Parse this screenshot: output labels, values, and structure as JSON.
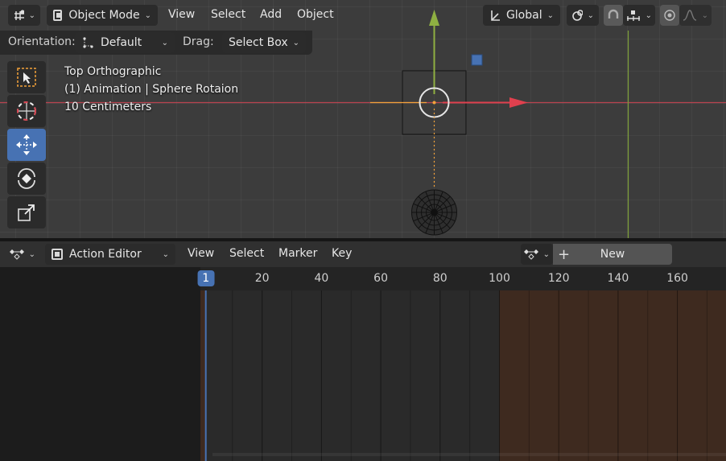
{
  "viewport_header": {
    "editor_type_icon": "grid-icon",
    "mode": "Object Mode",
    "menus": [
      "View",
      "Select",
      "Add",
      "Object"
    ],
    "transform_orientation": "Global",
    "pivot_icon": "pivot-link-icon",
    "snap_icon": "magnet-icon",
    "snap_target_icon": "snap-increment-icon",
    "proportional_icon": "proportional-edit-icon",
    "falloff_icon": "falloff-curve-icon"
  },
  "tool_settings": {
    "orientation_label": "Orientation:",
    "orientation_value": "Default",
    "drag_label": "Drag:",
    "drag_value": "Select Box"
  },
  "overlay": {
    "view_name": "Top Orthographic",
    "collection_info": "(1) Animation | Sphere Rotaion",
    "grid_scale": "10 Centimeters"
  },
  "toolbar": {
    "tools": [
      {
        "name": "select-box",
        "icon": "select-box-icon",
        "active": false
      },
      {
        "name": "cursor",
        "icon": "cursor-icon",
        "active": false
      },
      {
        "name": "move",
        "icon": "move-icon",
        "active": true
      },
      {
        "name": "rotate",
        "icon": "rotate-icon",
        "active": false
      },
      {
        "name": "scale",
        "icon": "scale-icon",
        "active": false
      }
    ]
  },
  "action_header": {
    "editor_icon": "dopesheet-icon",
    "mode": "Action Editor",
    "menus": [
      "View",
      "Select",
      "Marker",
      "Key"
    ],
    "new_button": "New",
    "new_icon": "plus-icon",
    "action_icon": "action-icon"
  },
  "timeline": {
    "current_frame": "1",
    "ticks": [
      "20",
      "40",
      "60",
      "80",
      "100",
      "120",
      "140",
      "160"
    ],
    "frame_start": 1,
    "frame_end": 100
  },
  "colors": {
    "accent": "#4772b3",
    "x_axis": "#d8434f",
    "y_axis": "#8fb042",
    "out_of_range": "#3e2a1f",
    "object_origin": "#f3a23a"
  }
}
